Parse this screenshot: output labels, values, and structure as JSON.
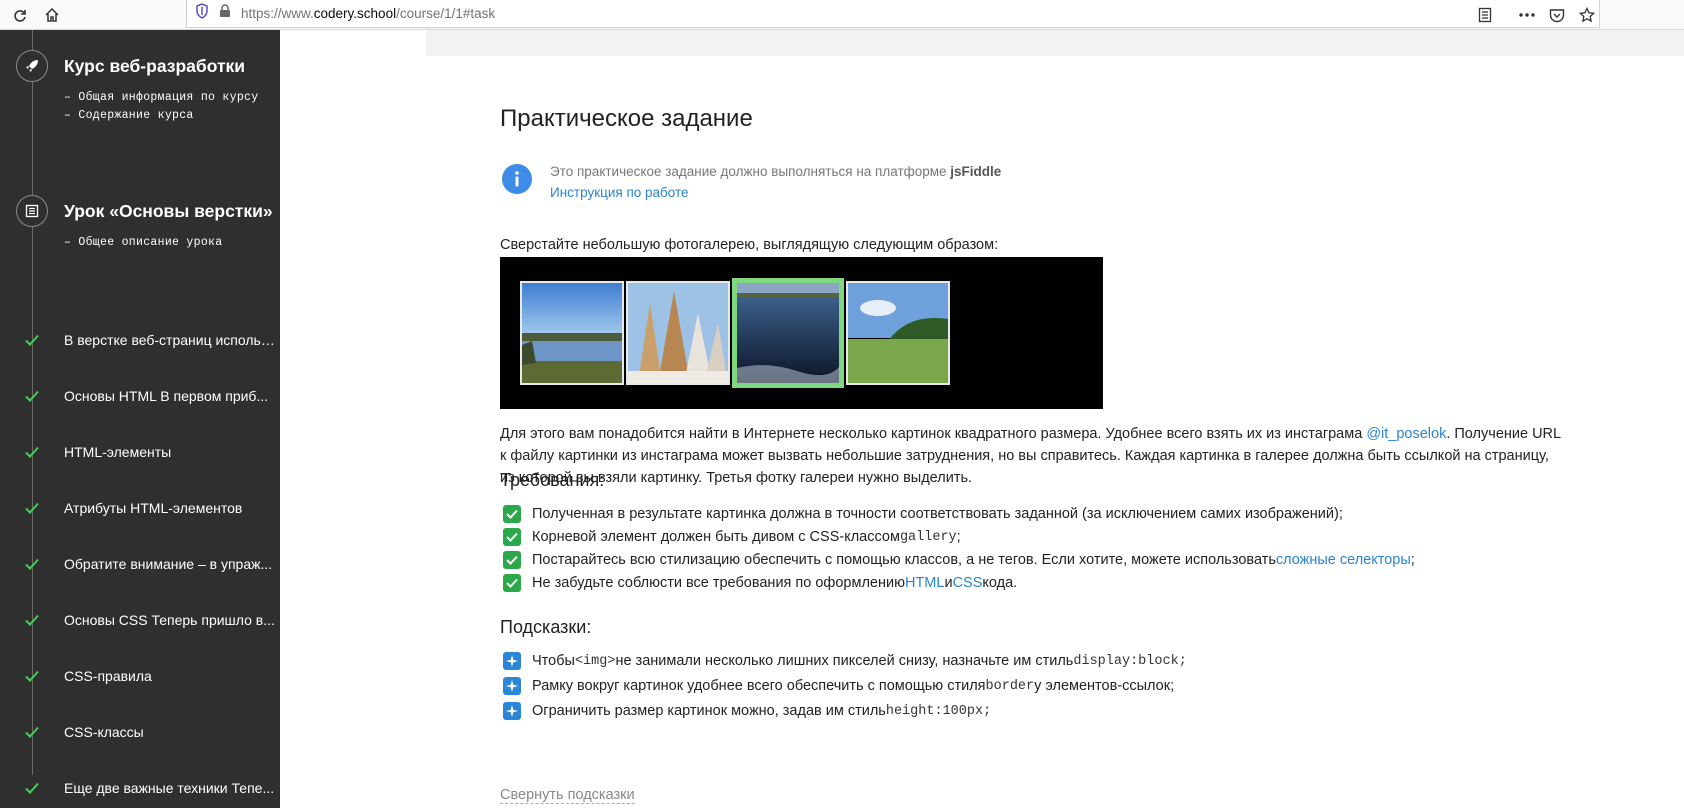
{
  "browser": {
    "url_prefix": "https://www.",
    "url_host": "codery.school",
    "url_path": "/course/1/1#task"
  },
  "sidebar": {
    "course_title": "Курс веб-разработки",
    "course_links": [
      "– Общая информация по курсу",
      "– Содержание курса"
    ],
    "lesson_title": "Урок «Основы верстки»",
    "lesson_links": [
      "– Общее описание урока"
    ],
    "steps": [
      {
        "label": "В верстке веб-страниц использ..."
      },
      {
        "label": "Основы HTML В первом приб..."
      },
      {
        "label": "HTML-элементы"
      },
      {
        "label": "Атрибуты HTML-элементов"
      },
      {
        "label": "Обратите внимание – в упраж..."
      },
      {
        "label": "Основы CSS Теперь пришло в..."
      },
      {
        "label": "CSS-правила"
      },
      {
        "label": "CSS-классы"
      },
      {
        "label": "Еще две важные техники Тепе..."
      }
    ]
  },
  "main": {
    "title": "Практическое задание",
    "info_text": "Это практическое задание должно выполняться на платформе ",
    "info_platform": "jsFiddle",
    "info_link": "Инструкция по работе",
    "intro": "Сверстайте небольшую фотогалерею, выглядящую следующим образом:",
    "gallery": {
      "images": [
        {
          "name": "lake-image",
          "selected": false
        },
        {
          "name": "winter-trees-image",
          "selected": false
        },
        {
          "name": "frozen-lake-image",
          "selected": true
        },
        {
          "name": "meadow-image",
          "selected": false
        }
      ]
    },
    "para": {
      "line1_a": "Для этого вам понадобится найти в Интернете несколько картинок квадратного размера. Удобнее всего взять их из инстаграма ",
      "line1_link": "@it_poselok",
      "line1_b": ". Получение URL",
      "line2": "к файлу картинки из инстаграма может вызвать небольшие затруднения, но вы справитесь. Каждая картинка в галерее должна быть ссылкой на страницу,",
      "line3": "из которой вы взяли картинку. Третья фотку галереи нужно выделить."
    },
    "requirements_title": "Требования:",
    "requirements": {
      "r1": "Полученная в результате картинка должна в точности соответствовать заданной (за исключением самих изображений);",
      "r2_a": "Корневой элемент должен быть дивом с CSS-классом ",
      "r2_code": "gallery",
      "r2_b": ";",
      "r3_a": "Постарайтесь всю стилизацию обеспечить с помощью классов, а не тегов. Если хотите, можете использовать ",
      "r3_link": "сложные селекторы",
      "r3_b": ";",
      "r4_a": "Не забудьте соблюсти все требования по оформлению ",
      "r4_link1": "HTML",
      "r4_mid": " и ",
      "r4_link2": "CSS",
      "r4_b": " кода."
    },
    "hints_title": "Подсказки:",
    "hints": {
      "h1_a": "Чтобы ",
      "h1_code1": "<img>",
      "h1_b": " не занимали несколько лишних пикселей снизу, назначьте им стиль ",
      "h1_code2": "display:block;",
      "h2_a": "Рамку вокруг картинок удобнее всего обеспечить с помощью стиля ",
      "h2_code": "border",
      "h2_b": " у элементов-ссылок;",
      "h3_a": "Ограничить размер картинок можно, задав им стиль ",
      "h3_code": "height:100px;"
    },
    "collapse_hints": "Свернуть подсказки"
  },
  "colors": {
    "sidebar_bg": "#2f2f2f",
    "check_green": "#4cc95a",
    "accent_blue": "#2a84d2",
    "selected_border": "#7fd87f"
  }
}
